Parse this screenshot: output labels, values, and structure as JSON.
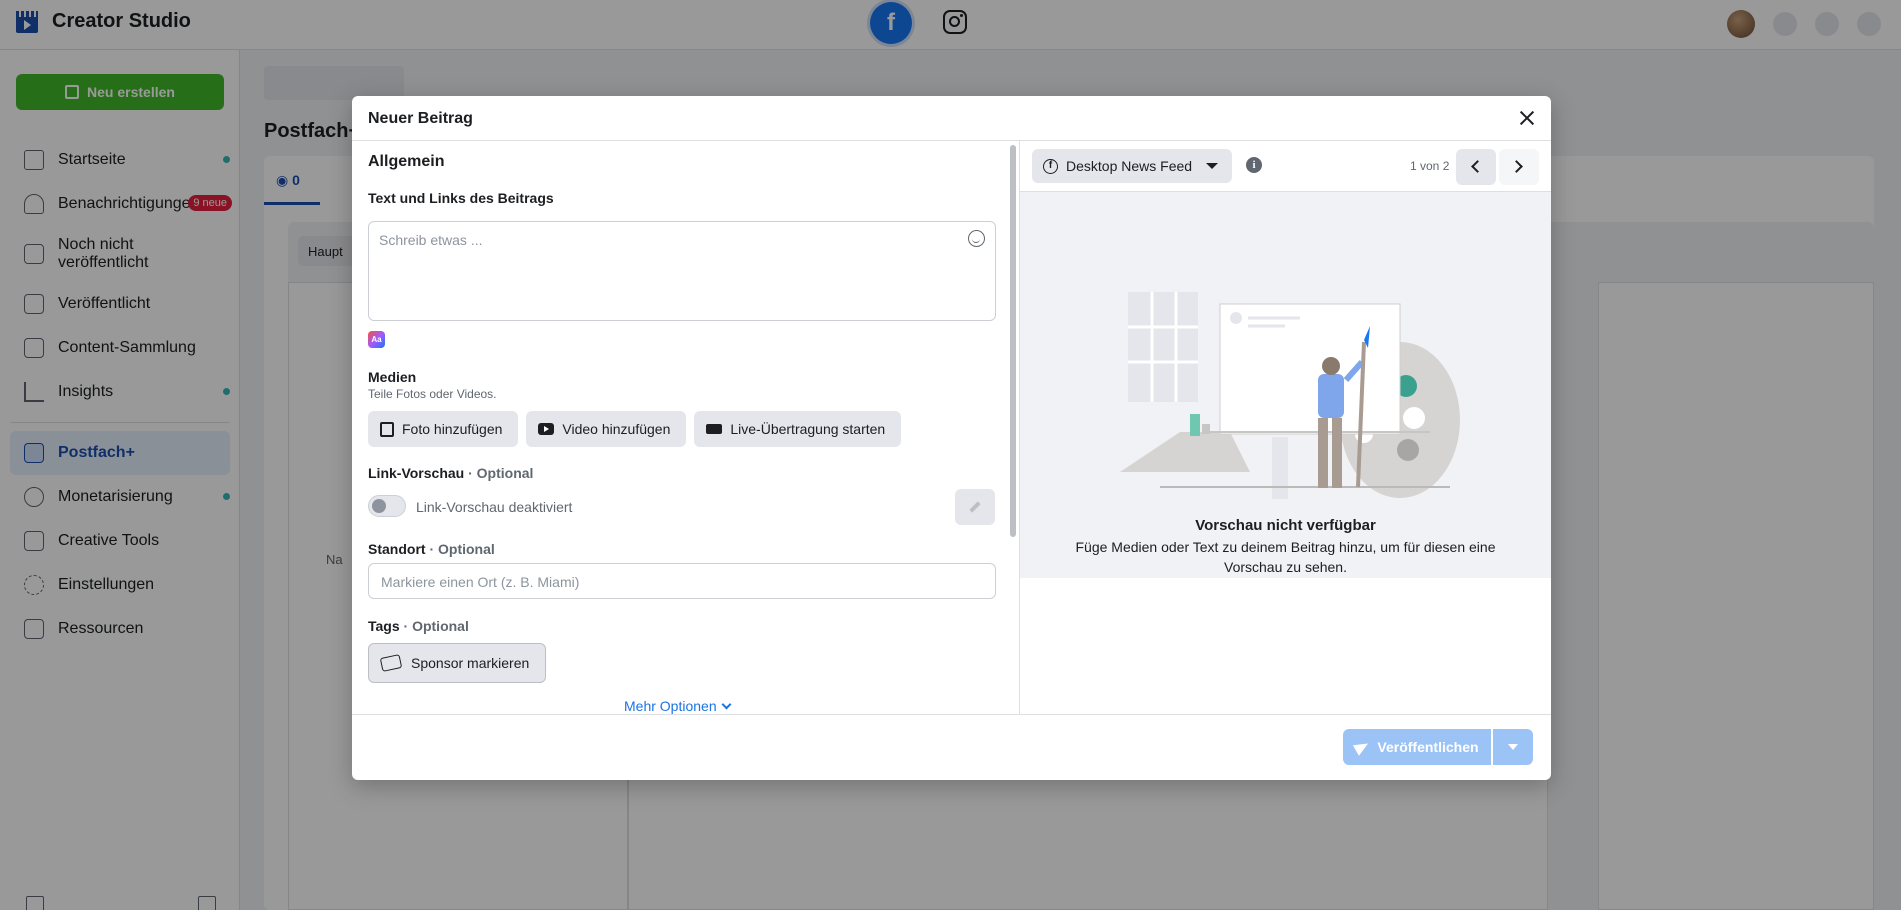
{
  "app": {
    "title": "Creator Studio",
    "platforms": [
      "Facebook",
      "Instagram"
    ]
  },
  "sidebar": {
    "new_button": "Neu erstellen",
    "items": [
      {
        "label": "Startseite",
        "icon": "home-icon",
        "dot": true
      },
      {
        "label": "Benachrichtigungen",
        "icon": "bell-icon",
        "badge": "9 neue"
      },
      {
        "label": "Noch nicht veröffentlicht",
        "icon": "document-icon"
      },
      {
        "label": "Veröffentlicht",
        "icon": "published-icon"
      },
      {
        "label": "Content-Sammlung",
        "icon": "library-icon"
      },
      {
        "label": "Insights",
        "icon": "insights-icon",
        "dot": true
      },
      {
        "label": "Postfach+",
        "icon": "inbox-icon",
        "active": true
      },
      {
        "label": "Monetarisierung",
        "icon": "dollar-icon",
        "dot": true
      },
      {
        "label": "Creative Tools",
        "icon": "creative-tools-icon"
      },
      {
        "label": "Einstellungen",
        "icon": "gear-icon"
      },
      {
        "label": "Ressourcen",
        "icon": "resources-icon"
      }
    ]
  },
  "main": {
    "page_heading": "Postfach+",
    "tab_count": "0",
    "inner_pill": "Haupt",
    "inner_note": "Na"
  },
  "dialog": {
    "title": "Neuer Beitrag",
    "section_general": "Allgemein",
    "text_label": "Text und Links des Beitrags",
    "text_placeholder": "Schreib etwas ...",
    "media_label": "Medien",
    "media_sub": "Teile Fotos oder Videos.",
    "add_photo": "Foto hinzufügen",
    "add_video": "Video hinzufügen",
    "start_live": "Live-Übertragung starten",
    "link_preview_label": "Link-Vorschau",
    "optional": "· Optional",
    "link_preview_toggle": "Link-Vorschau deaktiviert",
    "location_label": "Standort",
    "location_placeholder": "Markiere einen Ort (z. B. Miami)",
    "tags_label": "Tags",
    "sponsor_button": "Sponsor markieren",
    "more_options": "Mehr Optionen",
    "preview_placement": "Desktop News Feed",
    "preview_pager": "1 von 2",
    "preview_title": "Vorschau nicht verfügbar",
    "preview_desc": "Füge Medien oder Text zu deinem Beitrag hinzu, um für diesen eine Vorschau zu sehen.",
    "publish_button": "Veröffentlichen"
  },
  "colors": {
    "brand_blue": "#1b4fb0",
    "create_green": "#42b72a",
    "publish_disabled": "#9cc3f5",
    "badge_red": "#e41e3f",
    "status_dot": "#36b7b2"
  }
}
